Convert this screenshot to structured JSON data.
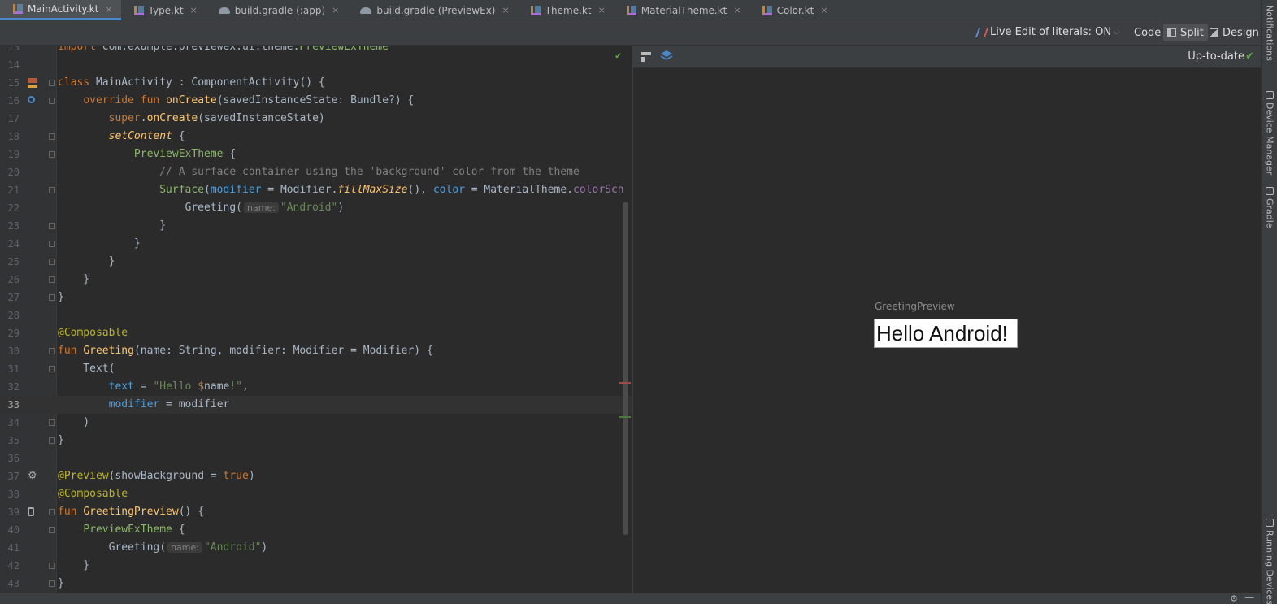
{
  "tabs": [
    {
      "label": "MainActivity.kt",
      "icon": "kotlin-file-icon",
      "active": true
    },
    {
      "label": "Type.kt",
      "icon": "kotlin-file-icon",
      "active": false
    },
    {
      "label": "build.gradle (:app)",
      "icon": "gradle-icon",
      "active": false
    },
    {
      "label": "build.gradle (PreviewEx)",
      "icon": "gradle-icon",
      "active": false
    },
    {
      "label": "Theme.kt",
      "icon": "kotlin-file-icon",
      "active": false
    },
    {
      "label": "MaterialTheme.kt",
      "icon": "kotlin-file-icon",
      "active": false
    },
    {
      "label": "Color.kt",
      "icon": "kotlin-file-icon",
      "active": false
    }
  ],
  "tab_close_glyph": "×",
  "tab_menu_glyph": "⋮",
  "toolbar": {
    "live_edit_label": "Live Edit of literals: ON",
    "live_edit_chevron": "⌵",
    "code_label": "Code",
    "split_label": "Split",
    "design_label": "Design",
    "selected_mode": "Split"
  },
  "editor": {
    "current_line": 33,
    "status_check": "✔",
    "lines": [
      {
        "n": "13",
        "text": "import com.example.previewex.ui.theme.PreviewExTheme"
      },
      {
        "n": "14",
        "text": ""
      },
      {
        "n": "15",
        "text": "class MainActivity : ComponentActivity() {"
      },
      {
        "n": "16",
        "text": "    override fun onCreate(savedInstanceState: Bundle?) {"
      },
      {
        "n": "17",
        "text": "        super.onCreate(savedInstanceState)"
      },
      {
        "n": "18",
        "text": "        setContent {"
      },
      {
        "n": "19",
        "text": "            PreviewExTheme {"
      },
      {
        "n": "20",
        "text": "                // A surface container using the 'background' color from the theme"
      },
      {
        "n": "21",
        "text": "                Surface(modifier = Modifier.fillMaxSize(), color = MaterialTheme.colorSch"
      },
      {
        "n": "22",
        "text": "                    Greeting( name: \"Android\")"
      },
      {
        "n": "23",
        "text": "                }"
      },
      {
        "n": "24",
        "text": "            }"
      },
      {
        "n": "25",
        "text": "        }"
      },
      {
        "n": "26",
        "text": "    }"
      },
      {
        "n": "27",
        "text": "}"
      },
      {
        "n": "28",
        "text": ""
      },
      {
        "n": "29",
        "text": "@Composable"
      },
      {
        "n": "30",
        "text": "fun Greeting(name: String, modifier: Modifier = Modifier) {"
      },
      {
        "n": "31",
        "text": "    Text("
      },
      {
        "n": "32",
        "text": "        text = \"Hello $name!\","
      },
      {
        "n": "33",
        "text": "        modifier = modifier"
      },
      {
        "n": "34",
        "text": "    )"
      },
      {
        "n": "35",
        "text": "}"
      },
      {
        "n": "36",
        "text": ""
      },
      {
        "n": "37",
        "text": "@Preview(showBackground = true)"
      },
      {
        "n": "38",
        "text": "@Composable"
      },
      {
        "n": "39",
        "text": "fun GreetingPreview() {"
      },
      {
        "n": "40",
        "text": "    PreviewExTheme {"
      },
      {
        "n": "41",
        "text": "        Greeting( name: \"Android\")"
      },
      {
        "n": "42",
        "text": "    }"
      },
      {
        "n": "43",
        "text": "}"
      }
    ]
  },
  "preview": {
    "status_label": "Up-to-date",
    "status_check": "✔",
    "composable_name": "GreetingPreview",
    "rendered_text": "Hello Android!"
  },
  "right_tools": {
    "notifications": "Notifications",
    "device_manager": "Device Manager",
    "gradle": "Gradle",
    "running_devices": "Running Devices"
  },
  "statusbar": {
    "gear_glyph": "⚙",
    "minimize_glyph": "—"
  },
  "colors": {
    "background": "#2b2b2b",
    "chrome": "#3c3f41",
    "accent": "#4a88c7",
    "keyword": "#cc7832",
    "function": "#ffc66d",
    "string": "#6a8759",
    "annotation": "#bbb529",
    "success": "#5fa847"
  }
}
